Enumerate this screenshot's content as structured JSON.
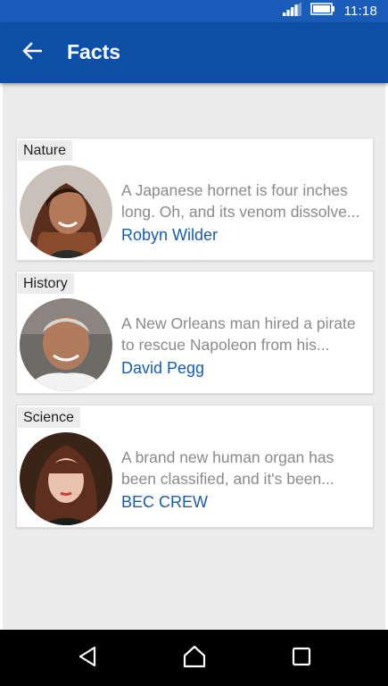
{
  "status_bar": {
    "time": "11:18",
    "icons": [
      "signal-icon",
      "battery-icon"
    ]
  },
  "app_bar": {
    "title": "Facts",
    "back_icon": "arrow-left-icon"
  },
  "facts": [
    {
      "category": "Nature",
      "line1": "A Japanese hornet is four inches",
      "line2": "long. Oh, and its venom dissolve...",
      "author": "Robyn Wilder"
    },
    {
      "category": "History",
      "line1": "A New Orleans man hired a pirate",
      "line2": "to rescue Napoleon from his...",
      "author": "David Pegg"
    },
    {
      "category": "Science",
      "line1": "A brand new human organ has",
      "line2": "been classified, and it's been...",
      "author": "BEC CREW"
    }
  ],
  "nav_bar": {
    "icons": [
      "back-triangle-icon",
      "home-icon",
      "recents-icon"
    ]
  },
  "colors": {
    "status_bar": "#1a5db8",
    "app_bar": "#0d4fa6",
    "author_link": "#1a5ca6",
    "background": "#ececec"
  }
}
